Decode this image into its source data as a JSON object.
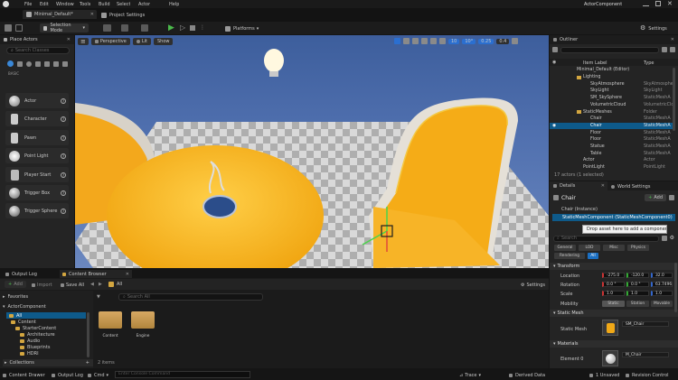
{
  "menu": {
    "items": [
      "File",
      "Edit",
      "Window",
      "Tools",
      "Build",
      "Select",
      "Actor",
      "Help"
    ],
    "right_title": "ActorComponent"
  },
  "tabs": {
    "level": "Minimal_Default*",
    "settings": "Project Settings"
  },
  "toolbar": {
    "selection_mode": "Selection Mode",
    "platforms": "Platforms",
    "settings": "Settings"
  },
  "place_actors": {
    "title": "Place Actors",
    "search_placeholder": "Search Classes",
    "category": "BASIC",
    "items": [
      "Actor",
      "Character",
      "Pawn",
      "Point Light",
      "Player Start",
      "Trigger Box",
      "Trigger Sphere"
    ]
  },
  "viewport": {
    "perspective": "Perspective",
    "lit": "Lit",
    "show": "Show",
    "grid_value": "10",
    "angle_value": "10°",
    "scale_value": "0.25",
    "speed_value": "0.4"
  },
  "outliner": {
    "title": "Outliner",
    "col_label": "Item Label",
    "col_type": "Type",
    "rows": [
      {
        "name": "Minimal_Default (Editor)",
        "type": ""
      },
      {
        "name": "Lighting",
        "type": ""
      },
      {
        "name": "SkyAtmosphere",
        "type": "SkyAtmosphe"
      },
      {
        "name": "SkyLight",
        "type": "SkyLight"
      },
      {
        "name": "SM_SkySphere",
        "type": "StaticMeshA"
      },
      {
        "name": "VolumetricCloud",
        "type": "VolumetricClo"
      },
      {
        "name": "StaticMeshes",
        "type": "Folder"
      },
      {
        "name": "Chair",
        "type": "StaticMeshA"
      },
      {
        "name": "Chair",
        "type": "StaticMeshA"
      },
      {
        "name": "Floor",
        "type": "StaticMeshA"
      },
      {
        "name": "Floor",
        "type": "StaticMeshA"
      },
      {
        "name": "Statue",
        "type": "StaticMeshA"
      },
      {
        "name": "Table",
        "type": "StaticMeshA"
      },
      {
        "name": "Actor",
        "type": "Actor"
      },
      {
        "name": "PointLight",
        "type": "PointLight"
      }
    ],
    "status": "17 actors (1 selected)"
  },
  "details": {
    "title": "Details",
    "world_settings": "World Settings",
    "object_name": "Chair",
    "add_label": "Add",
    "instance_label": "Chair (Instance)",
    "component_label": "StaticMeshComponent (StaticMeshComponent0)",
    "tooltip": "Drop asset here to add a component.",
    "search_placeholder": "Search",
    "tabs_row1": [
      "General",
      "LOD",
      "Misc",
      "Physics"
    ],
    "tabs_row2": [
      "Rendering",
      "All"
    ],
    "transform_header": "Transform",
    "location_label": "Location",
    "location": [
      "-275.0",
      "-120.0",
      "32.0"
    ],
    "rotation_label": "Rotation",
    "rotation": [
      "0.0 °",
      "0.0 °",
      "63.7496"
    ],
    "scale_label": "Scale",
    "scale": [
      "1.0",
      "1.0",
      "1.0"
    ],
    "mobility_label": "Mobility",
    "mobility_options": [
      "Static",
      "Station",
      "Movable"
    ],
    "static_mesh_header": "Static Mesh",
    "static_mesh_label": "Static Mesh",
    "static_mesh_value": "SM_Chair",
    "materials_header": "Materials",
    "element0_label": "Element 0",
    "element0_value": "M_Chair"
  },
  "bottom": {
    "output_log_tab": "Output Log",
    "content_browser_tab": "Content Browser",
    "add": "Add",
    "import": "Import",
    "save_all": "Save All",
    "settings": "Settings",
    "path": "All",
    "search_placeholder": "Search All",
    "favorites": "Favorites",
    "project": "ActorComponent",
    "tree": [
      "All",
      "Content",
      "StarterContent",
      "Architecture",
      "Audio",
      "Blueprints",
      "HDRI"
    ],
    "folders": [
      "Content",
      "Engine"
    ],
    "items_count": "2 items",
    "collections": "Collections"
  },
  "statusbar": {
    "content_drawer": "Content Drawer",
    "output_log": "Output Log",
    "cmd": "Cmd",
    "console_placeholder": "Enter Console Command",
    "trace": "Trace",
    "derived": "Derived Data",
    "unsaved": "1 Unsaved",
    "revision": "Revision Control"
  },
  "colors": {
    "accent": "#0e70c0",
    "sky": "#4a6aa8",
    "chair": "#f0a817"
  }
}
